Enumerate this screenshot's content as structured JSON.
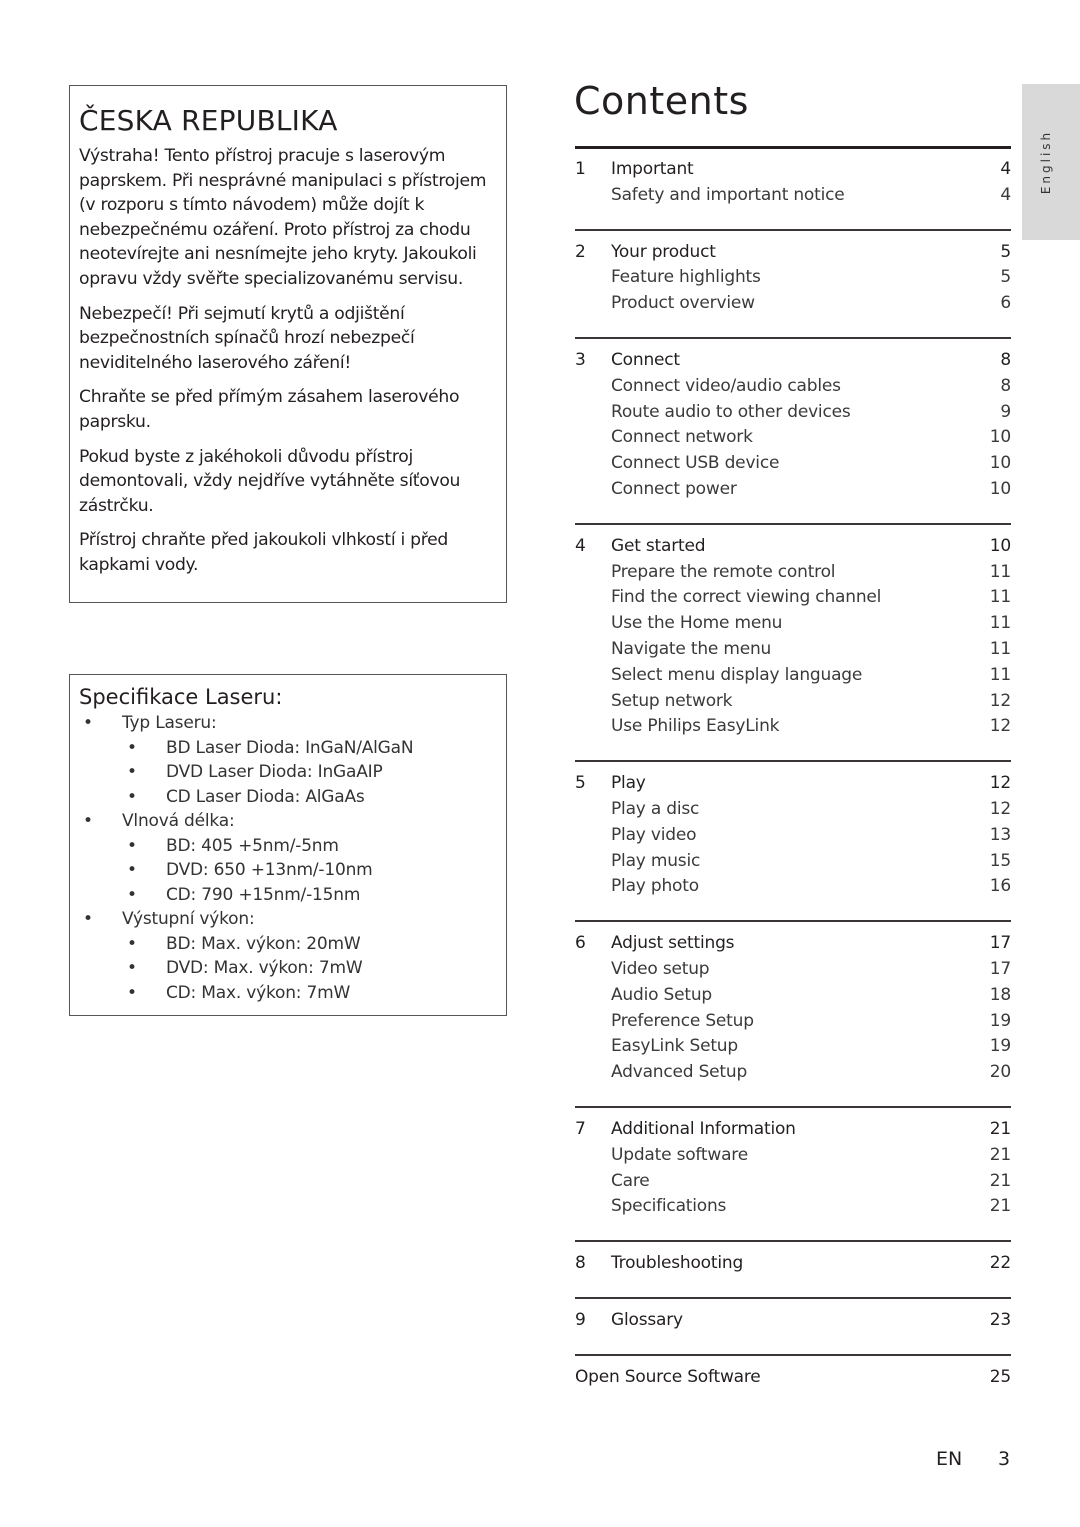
{
  "czech_box": {
    "title": "ČESKA REPUBLIKA",
    "paragraphs": [
      "Výstraha! Tento přístroj pracuje s laserovým paprskem. Při nesprávné manipulaci s přístrojem (v rozporu s tímto návodem) může dojít k nebezpečnému ozáření. Proto přístroj za chodu neotevírejte ani nesnímejte jeho kryty. Jakoukoli opravu vždy svěřte specializovanému servisu.",
      "Nebezpečí! Při sejmutí krytů a odjištění bezpečnostních spínačů hrozí nebezpečí neviditelného laserového záření!",
      "Chraňte se před přímým zásahem laserového paprsku.",
      "Pokud byste z jakéhokoli důvodu přístroj demontovali, vždy nejdříve vytáhněte síťovou zástrčku.",
      "Přístroj chraňte před jakoukoli vlhkostí i před kapkami vody."
    ]
  },
  "laser_spec": {
    "title": "Specifikace Laseru:",
    "bullet": "•",
    "items": [
      {
        "level": 1,
        "text": "Typ Laseru:"
      },
      {
        "level": 2,
        "text": "BD Laser Dioda: InGaN/AlGaN"
      },
      {
        "level": 2,
        "text": "DVD Laser Dioda:  InGaAIP"
      },
      {
        "level": 2,
        "text": "CD Laser Dioda: AlGaAs"
      },
      {
        "level": 1,
        "text": "Vlnová délka:"
      },
      {
        "level": 2,
        "text": "BD:  405 +5nm/-5nm"
      },
      {
        "level": 2,
        "text": "DVD:  650 +13nm/-10nm"
      },
      {
        "level": 2,
        "text": "CD:  790 +15nm/-15nm"
      },
      {
        "level": 1,
        "text": "Výstupní výkon:"
      },
      {
        "level": 2,
        "text": "BD:  Max. výkon: 20mW"
      },
      {
        "level": 2,
        "text": "DVD:  Max. výkon: 7mW"
      },
      {
        "level": 2,
        "text": "CD:  Max. výkon: 7mW"
      }
    ]
  },
  "contents": {
    "title": "Contents",
    "sections": [
      {
        "num": "1",
        "title": "Important",
        "page": "4",
        "items": [
          {
            "title": "Safety and important notice",
            "page": "4"
          }
        ]
      },
      {
        "num": "2",
        "title": "Your product",
        "page": "5",
        "items": [
          {
            "title": "Feature highlights",
            "page": "5"
          },
          {
            "title": "Product overview",
            "page": "6"
          }
        ]
      },
      {
        "num": "3",
        "title": "Connect",
        "page": "8",
        "items": [
          {
            "title": "Connect video/audio cables",
            "page": "8"
          },
          {
            "title": "Route audio to other devices",
            "page": "9"
          },
          {
            "title": "Connect network",
            "page": "10"
          },
          {
            "title": "Connect USB device",
            "page": "10"
          },
          {
            "title": "Connect power",
            "page": "10"
          }
        ]
      },
      {
        "num": "4",
        "title": "Get started",
        "page": "10",
        "items": [
          {
            "title": "Prepare the remote control",
            "page": "11"
          },
          {
            "title": "Find the correct viewing channel",
            "page": "11"
          },
          {
            "title": "Use the Home menu",
            "page": "11"
          },
          {
            "title": "Navigate the menu",
            "page": "11"
          },
          {
            "title": "Select menu display language",
            "page": "11"
          },
          {
            "title": "Setup network",
            "page": "12"
          },
          {
            "title": "Use Philips EasyLink",
            "page": "12"
          }
        ]
      },
      {
        "num": "5",
        "title": "Play",
        "page": "12",
        "items": [
          {
            "title": "Play a disc",
            "page": "12"
          },
          {
            "title": "Play video",
            "page": "13"
          },
          {
            "title": "Play music",
            "page": "15"
          },
          {
            "title": "Play photo",
            "page": "16"
          }
        ]
      },
      {
        "num": "6",
        "title": "Adjust settings",
        "page": "17",
        "items": [
          {
            "title": "Video setup",
            "page": "17"
          },
          {
            "title": "Audio Setup",
            "page": "18"
          },
          {
            "title": "Preference Setup",
            "page": "19"
          },
          {
            "title": "EasyLink Setup",
            "page": "19"
          },
          {
            "title": "Advanced Setup",
            "page": "20"
          }
        ]
      },
      {
        "num": "7",
        "title": "Additional Information",
        "page": "21",
        "items": [
          {
            "title": "Update software",
            "page": "21"
          },
          {
            "title": "Care",
            "page": "21"
          },
          {
            "title": "Specifications",
            "page": "21"
          }
        ]
      },
      {
        "num": "8",
        "title": "Troubleshooting",
        "page": "22",
        "items": []
      },
      {
        "num": "9",
        "title": "Glossary",
        "page": "23",
        "items": []
      },
      {
        "num": "",
        "title": "Open Source Software",
        "page": "25",
        "items": []
      }
    ]
  },
  "language_tab": "English",
  "footer": {
    "lang": "EN",
    "page": "3"
  }
}
